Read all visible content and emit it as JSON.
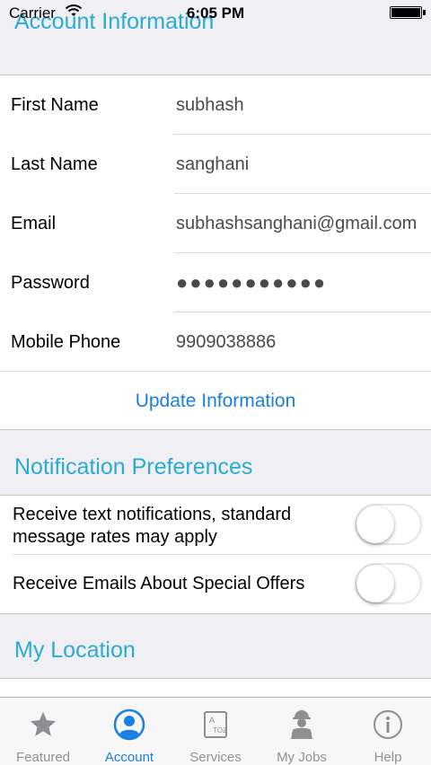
{
  "status_bar": {
    "carrier": "Carrier",
    "time": "6:05 PM"
  },
  "account": {
    "header": "Account Information",
    "fields": [
      {
        "label": "First Name",
        "value": "subhash"
      },
      {
        "label": "Last Name",
        "value": "sanghani"
      },
      {
        "label": "Email",
        "value": "subhashsanghani@gmail.com"
      },
      {
        "label": "Password",
        "value": "●●●●●●●●●●●"
      },
      {
        "label": "Mobile Phone",
        "value": "9909038886"
      }
    ],
    "update_label": "Update Information"
  },
  "notifications": {
    "header": "Notification Preferences",
    "items": [
      {
        "label": "Receive text notifications, standard message rates may apply",
        "on": false
      },
      {
        "label": "Receive Emails About Special Offers",
        "on": false
      }
    ]
  },
  "location": {
    "header": "My Location"
  },
  "tabbar": {
    "tabs": [
      {
        "label": "Featured",
        "icon": "star-icon",
        "active": false
      },
      {
        "label": "Account",
        "icon": "account-icon",
        "active": true
      },
      {
        "label": "Services",
        "icon": "services-icon",
        "active": false
      },
      {
        "label": "My Jobs",
        "icon": "worker-icon",
        "active": false
      },
      {
        "label": "Help",
        "icon": "info-icon",
        "active": false
      }
    ],
    "active_color": "#1a7fe0",
    "inactive_color": "#929292"
  },
  "colors": {
    "section_header": "#2aabd2",
    "link": "#1a7fe0",
    "background": "#efeff4"
  }
}
